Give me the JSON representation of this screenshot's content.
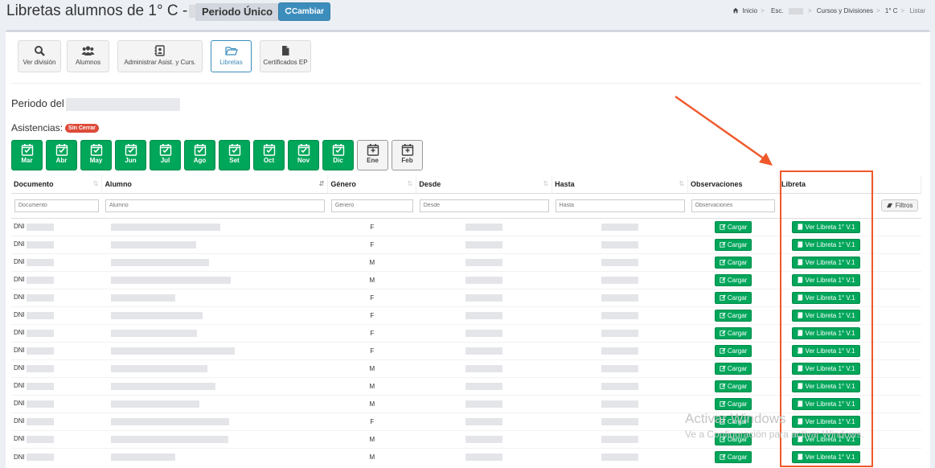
{
  "header": {
    "title": "Libretas alumnos de 1° C -",
    "periodo": "Periodo Único",
    "cambiar": "Cambiar",
    "breadcrumb": {
      "inicio": "Inicio",
      "esc": "Esc.",
      "cursos": "Cursos y Divisiones",
      "curso": "1° C",
      "listar": "Listar"
    }
  },
  "toolbar": [
    {
      "label": "Ver división",
      "icon": "search-icon"
    },
    {
      "label": "Alumnos",
      "icon": "users-icon"
    },
    {
      "label": "Administrar Asist. y Curs.",
      "icon": "contact-card-icon"
    },
    {
      "label": "Libretas",
      "icon": "folder-open-icon"
    },
    {
      "label": "Certificados EP",
      "icon": "file-icon"
    }
  ],
  "periodo_label": "Periodo del",
  "asistencias": {
    "label": "Asistencias:",
    "badge": "Sin Cerrar"
  },
  "months": [
    {
      "label": "Mar",
      "closed": true
    },
    {
      "label": "Abr",
      "closed": true
    },
    {
      "label": "May",
      "closed": true
    },
    {
      "label": "Jun",
      "closed": true
    },
    {
      "label": "Jul",
      "closed": true
    },
    {
      "label": "Ago",
      "closed": true
    },
    {
      "label": "Set",
      "closed": true
    },
    {
      "label": "Oct",
      "closed": true
    },
    {
      "label": "Nov",
      "closed": true
    },
    {
      "label": "Dic",
      "closed": true
    },
    {
      "label": "Ene",
      "closed": false
    },
    {
      "label": "Feb",
      "closed": false
    }
  ],
  "table": {
    "columns": [
      "Documento",
      "Alumno",
      "Género",
      "Desde",
      "Hasta",
      "Observaciones",
      "Libreta"
    ],
    "filters": [
      "Documento",
      "Alumno",
      "Género",
      "Desde",
      "Hasta",
      "Observaciones"
    ],
    "filter_button": "Filtros",
    "rows": [
      {
        "doc": "DNI",
        "genero": "F",
        "obs": "Cargar",
        "libreta": "Ver Libreta 1° V.1"
      },
      {
        "doc": "DNI",
        "genero": "F",
        "obs": "Cargar",
        "libreta": "Ver Libreta 1° V.1"
      },
      {
        "doc": "DNI",
        "genero": "M",
        "obs": "Cargar",
        "libreta": "Ver Libreta 1° V.1"
      },
      {
        "doc": "DNI",
        "genero": "M",
        "obs": "Cargar",
        "libreta": "Ver Libreta 1° V.1"
      },
      {
        "doc": "DNI",
        "genero": "F",
        "obs": "Cargar",
        "libreta": "Ver Libreta 1° V.1"
      },
      {
        "doc": "DNI",
        "genero": "F",
        "obs": "Cargar",
        "libreta": "Ver Libreta 1° V.1"
      },
      {
        "doc": "DNI",
        "genero": "F",
        "obs": "Cargar",
        "libreta": "Ver Libreta 1° V.1"
      },
      {
        "doc": "DNI",
        "genero": "F",
        "obs": "Cargar",
        "libreta": "Ver Libreta 1° V.1"
      },
      {
        "doc": "DNI",
        "genero": "M",
        "obs": "Cargar",
        "libreta": "Ver Libreta 1° V.1"
      },
      {
        "doc": "DNI",
        "genero": "M",
        "obs": "Cargar",
        "libreta": "Ver Libreta 1° V.1"
      },
      {
        "doc": "DNI",
        "genero": "M",
        "obs": "Cargar",
        "libreta": "Ver Libreta 1° V.1"
      },
      {
        "doc": "DNI",
        "genero": "F",
        "obs": "Cargar",
        "libreta": "Ver Libreta 1° V.1"
      },
      {
        "doc": "DNI",
        "genero": "M",
        "obs": "Cargar",
        "libreta": "Ver Libreta 1° V.1"
      },
      {
        "doc": "DNI",
        "genero": "M",
        "obs": "Cargar",
        "libreta": "Ver Libreta 1° V.1"
      }
    ]
  },
  "watermark": {
    "title": "Activar Windows",
    "subtitle": "Ve a Configuración para activar Windows."
  },
  "colors": {
    "primary": "#3c8dbc",
    "success": "#00a65a",
    "danger": "#dd4b39",
    "highlight": "#f0582b"
  }
}
